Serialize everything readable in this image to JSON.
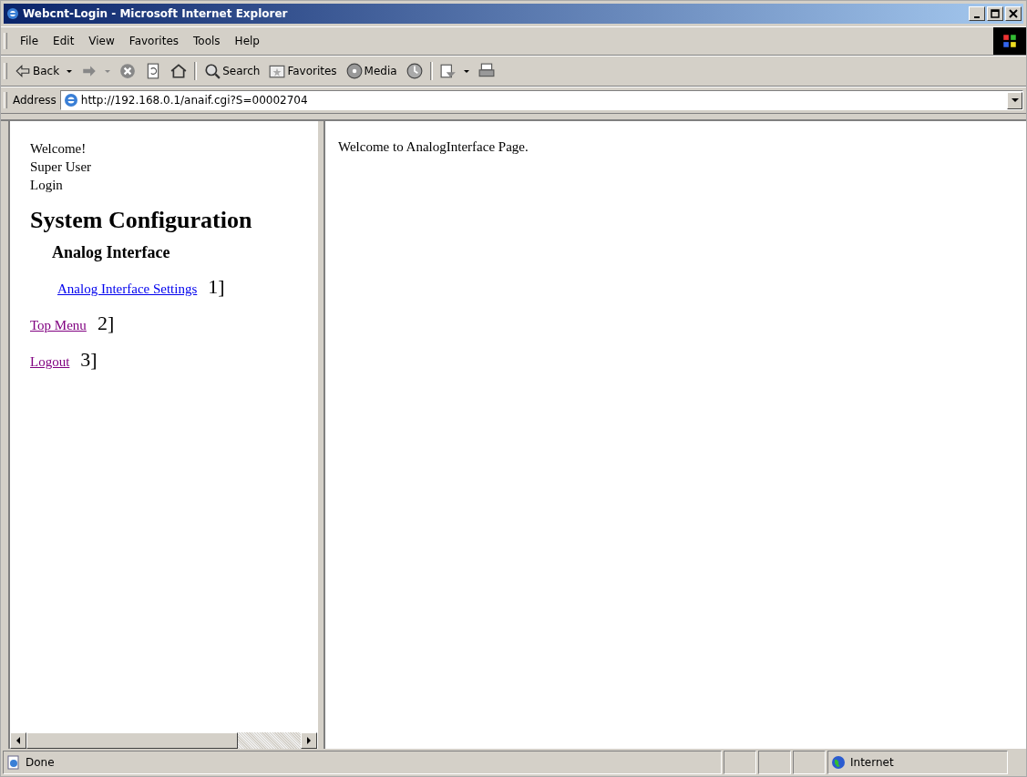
{
  "window": {
    "title": "Webcnt-Login - Microsoft Internet Explorer"
  },
  "menu": [
    "File",
    "Edit",
    "View",
    "Favorites",
    "Tools",
    "Help"
  ],
  "toolbar": [
    {
      "kind": "back",
      "label": "Back"
    },
    {
      "kind": "forward"
    },
    {
      "kind": "stop"
    },
    {
      "kind": "refresh"
    },
    {
      "kind": "home"
    },
    {
      "kind": "sep"
    },
    {
      "kind": "search",
      "label": "Search"
    },
    {
      "kind": "favorites",
      "label": "Favorites"
    },
    {
      "kind": "media",
      "label": "Media"
    },
    {
      "kind": "history"
    },
    {
      "kind": "sep"
    },
    {
      "kind": "mail"
    },
    {
      "kind": "print"
    }
  ],
  "address": {
    "label": "Address",
    "value": "http://192.168.0.1/anaif.cgi?S=00002704"
  },
  "left_frame": {
    "welcome": [
      "Welcome!",
      "Super User",
      "Login"
    ],
    "heading": "System Configuration",
    "subheading": "Analog Interface",
    "links": [
      {
        "text": "Analog Interface Settings",
        "note": "1]",
        "visited": false,
        "indented": true
      },
      {
        "text": "Top Menu",
        "note": "2]",
        "visited": true,
        "indented": false
      },
      {
        "text": "Logout",
        "note": "3]",
        "visited": true,
        "indented": false
      }
    ]
  },
  "right_frame": {
    "text": "Welcome to AnalogInterface Page."
  },
  "status_bar": {
    "text": "Done",
    "zone": "Internet"
  }
}
